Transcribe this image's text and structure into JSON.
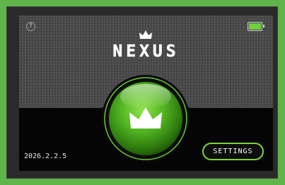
{
  "device": {
    "brand": "NEXUS",
    "date": "2026.2.2.5"
  },
  "buttons": {
    "settings_label": "SETTINGS"
  },
  "icons": {
    "help": "help-icon",
    "battery": "battery-icon",
    "logo_crown": "crown-icon",
    "power_crown": "crown-icon"
  },
  "status": {
    "battery_level": 1.0
  },
  "colors": {
    "accent_green": "#7fd23c",
    "frame_green": "#5fb54a",
    "button_green": "#4fae22"
  }
}
